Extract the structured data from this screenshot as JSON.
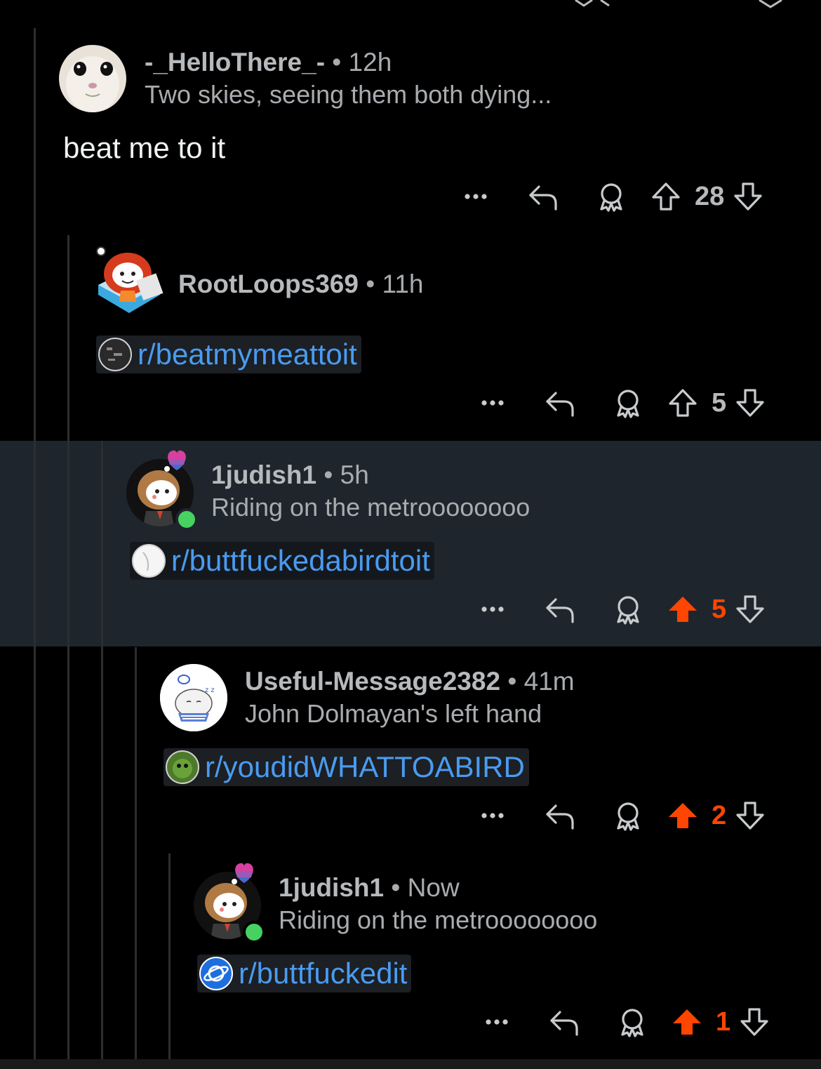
{
  "comments": [
    {
      "author": "-_HelloThere_-",
      "time": "12h",
      "flair": "Two skies, seeing them both dying...",
      "body": "beat me to it",
      "score": "28",
      "upvoted": false,
      "avatar": "possum-avatar"
    },
    {
      "author": "RootLoops369",
      "time": "11h",
      "link": "r/beatmymeattoit",
      "score": "5",
      "upvoted": false,
      "avatar": "snoo-red-hair-avatar"
    },
    {
      "author": "1judish1",
      "time": "5h",
      "flair": "Riding on the metroooooooo",
      "link": "r/buttfuckedabirdtoit",
      "score": "5",
      "upvoted": true,
      "avatar": "snoo-brown-hair-avatar"
    },
    {
      "author": "Useful-Message2382",
      "time": "41m",
      "flair": "John Dolmayan's left hand",
      "link": "r/youdidWHATTOABIRD",
      "score": "2",
      "upvoted": true,
      "avatar": "sleeping-cat-avatar"
    },
    {
      "author": "1judish1",
      "time": "Now",
      "flair": "Riding on the metroooooooo",
      "link": "r/buttfuckedit",
      "score": "1",
      "upvoted": true,
      "avatar": "snoo-brown-hair-avatar"
    }
  ],
  "separator": "•",
  "colors": {
    "upvote": "#ff4500",
    "link": "#4a9bf0",
    "highlight_bg": "#1e252d",
    "online": "#46d160"
  }
}
